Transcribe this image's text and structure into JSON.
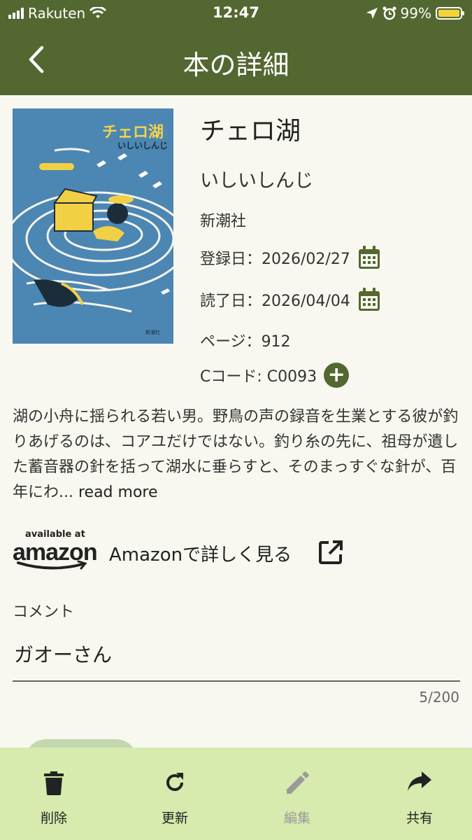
{
  "status_bar": {
    "carrier": "Rakuten",
    "time": "12:47",
    "battery": "99%",
    "battery_level": 0.99
  },
  "nav": {
    "title": "本の詳細",
    "back_icon": "chevron-left-icon"
  },
  "cover": {
    "title_text": "チェロ湖",
    "author_text": "いしいしんじ"
  },
  "book": {
    "title": "チェロ湖",
    "author": "いしいしんじ",
    "publisher": "新潮社",
    "registered_label": "登録日：",
    "registered_date": "2026/02/27",
    "read_label": "読了日：",
    "read_date": "2026/04/04",
    "pages_label": "ページ：",
    "pages": "912",
    "ccode_label": "Cコード: ",
    "ccode": "C0093"
  },
  "description": {
    "text": "湖の小舟に揺られる若い男。野鳥の声の録音を生業とする彼が釣りあげるのは、コアユだけではない。釣り糸の先に、祖母が遺した蓄音器の針を括って湖水に垂らすと、そのまっすぐな針が、百年にわ...",
    "more": " read more"
  },
  "amazon": {
    "available_at": "available at",
    "brand": "amazon",
    "link_text": "Amazonで詳しく見る"
  },
  "comment": {
    "label": "コメント",
    "value": "ガオーさん",
    "counter": "5/200"
  },
  "tabs": [
    {
      "label": "削除",
      "icon": "trash-icon"
    },
    {
      "label": "更新",
      "icon": "refresh-icon"
    },
    {
      "label": "編集",
      "icon": "pencil-icon"
    },
    {
      "label": "共有",
      "icon": "share-icon"
    }
  ],
  "colors": {
    "header": "#536830",
    "background": "#f8f8f0",
    "tab_bar": "#d6ebad",
    "cover": "#4c86b3"
  }
}
